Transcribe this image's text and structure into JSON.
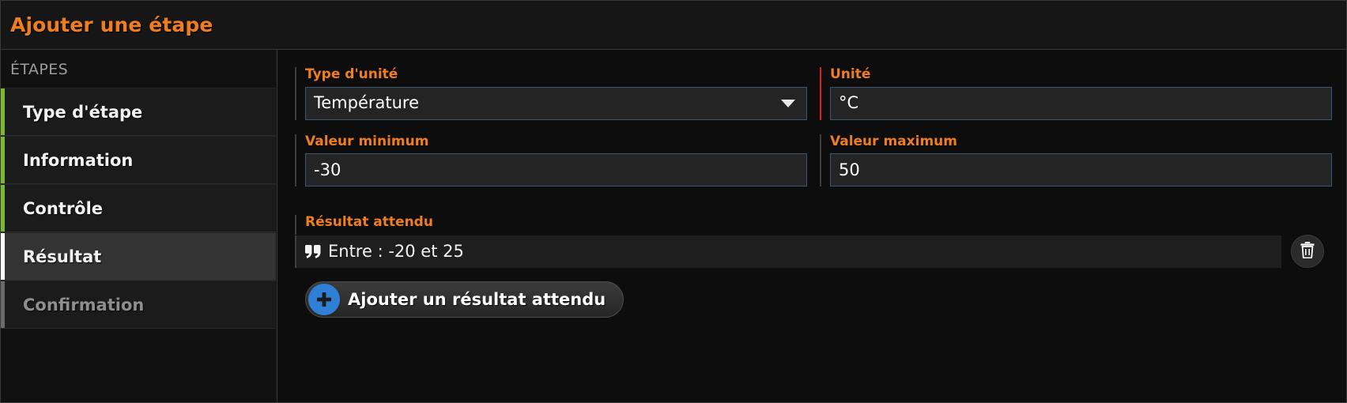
{
  "window": {
    "title": "Ajouter une étape",
    "accent_color": "#ef7d21",
    "error_color": "#e02020",
    "done_color": "#7bb832",
    "add_button_color": "#2f7fd6"
  },
  "sidebar": {
    "header": "ÉTAPES",
    "items": [
      {
        "label": "Type d'étape",
        "state": "done"
      },
      {
        "label": "Information",
        "state": "done"
      },
      {
        "label": "Contrôle",
        "state": "done"
      },
      {
        "label": "Résultat",
        "state": "active"
      },
      {
        "label": "Confirmation",
        "state": "todo"
      }
    ]
  },
  "form": {
    "unit_type": {
      "label": "Type d'unité",
      "value": "Température",
      "control": "select"
    },
    "unit": {
      "label": "Unité",
      "value": "°C",
      "control": "text",
      "invalid": true
    },
    "min_value": {
      "label": "Valeur minimum",
      "value": "-30",
      "control": "text"
    },
    "max_value": {
      "label": "Valeur maximum",
      "value": "50",
      "control": "text"
    }
  },
  "expected_result": {
    "label": "Résultat attendu",
    "rows": [
      {
        "text": "Entre : -20 et 25",
        "icon": "quote-left-icon"
      }
    ],
    "delete_icon": "trash-icon",
    "add_button": {
      "label": "Ajouter un résultat attendu",
      "icon": "plus-circle-icon"
    }
  }
}
